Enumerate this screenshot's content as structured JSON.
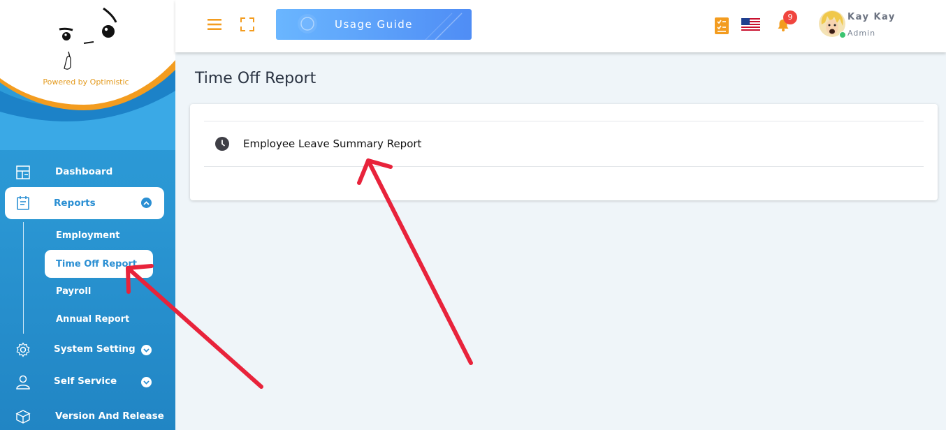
{
  "brand": {
    "powered_by": "Powered by Optimistic"
  },
  "sidebar": {
    "items": [
      {
        "label": "Dashboard",
        "icon": "dashboard-icon"
      },
      {
        "label": "Reports",
        "icon": "reports-icon",
        "expanded": true
      },
      {
        "label": "System Setting",
        "icon": "gear-icon"
      },
      {
        "label": "Self Service",
        "icon": "user-icon"
      },
      {
        "label": "Version And Release",
        "icon": "box-icon"
      }
    ],
    "submenu": [
      "Employment",
      "Time Off Report",
      "Payroll",
      "Annual Report"
    ]
  },
  "header": {
    "guide_label": "Usage Guide",
    "notification_count": "9",
    "user_name": "Kay Kay",
    "user_role": "Admin"
  },
  "main": {
    "title": "Time Off Report",
    "reports": [
      {
        "label": "Employee Leave Summary Report",
        "icon": "clock-icon"
      }
    ]
  },
  "colors": {
    "sidebar": "#2a96d3",
    "accent_orange": "#f39c1f",
    "badge": "#f0453e",
    "arrow": "#e8233b",
    "active_text": "#2b8fd3"
  }
}
